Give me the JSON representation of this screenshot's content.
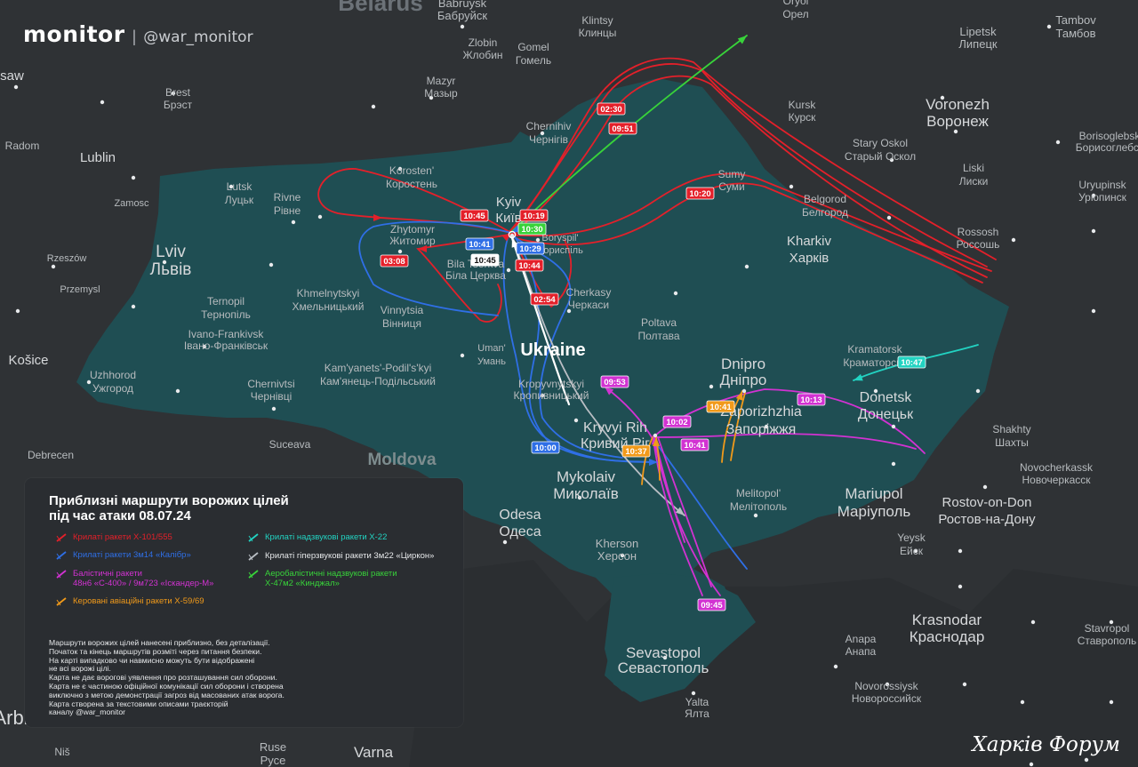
{
  "brand": {
    "name": "monitor",
    "separator": "|",
    "handle": "@war_monitor"
  },
  "watermark": "Харків Форум",
  "colors": {
    "ocean": "#2b2e31",
    "land_other": "#2f3235",
    "land_ukraine": "#1f4e53",
    "label": "#d0d2d4",
    "red": "#e4202a",
    "blue": "#2f6fe6",
    "magenta": "#d232d2",
    "orange": "#f19a1a",
    "cyan": "#22d3c2",
    "gray": "#b9bec4",
    "green": "#38d33a",
    "white": "#ffffff"
  },
  "country_labels": [
    {
      "text": "Belarus"
    },
    {
      "text": "Moldova"
    },
    {
      "text": "Ukraine"
    }
  ],
  "city_labels": [
    {
      "text": "Warsaw"
    },
    {
      "text": "Brest"
    },
    {
      "text": "Брэст"
    },
    {
      "text": "Lublin"
    },
    {
      "text": "Radom"
    },
    {
      "text": "Zamosc"
    },
    {
      "text": "Rzeszów"
    },
    {
      "text": "Przemysl"
    },
    {
      "text": "Košice"
    },
    {
      "text": "Debrecen"
    },
    {
      "text": "Babruysk"
    },
    {
      "text": "Бабруйск"
    },
    {
      "text": "Zlobin"
    },
    {
      "text": "Жлобин"
    },
    {
      "text": "Gomel"
    },
    {
      "text": "Гомель"
    },
    {
      "text": "Mazyr"
    },
    {
      "text": "Мазыр"
    },
    {
      "text": "Klintsy"
    },
    {
      "text": "Клинцы"
    },
    {
      "text": "Oryol"
    },
    {
      "text": "Орел"
    },
    {
      "text": "Tambov"
    },
    {
      "text": "Тамбов"
    },
    {
      "text": "Lipetsk"
    },
    {
      "text": "Липецк"
    },
    {
      "text": "Voronezh"
    },
    {
      "text": "Воронеж"
    },
    {
      "text": "Kursk"
    },
    {
      "text": "Курск"
    },
    {
      "text": "Stary Oskol"
    },
    {
      "text": "Старый Оскол"
    },
    {
      "text": "Borisoglebsk"
    },
    {
      "text": "Борисоглебск"
    },
    {
      "text": "Liski"
    },
    {
      "text": "Лиски"
    },
    {
      "text": "Uryupinsk"
    },
    {
      "text": "Урюпинск"
    },
    {
      "text": "Rossosh"
    },
    {
      "text": "Россошь"
    },
    {
      "text": "Chernihiv"
    },
    {
      "text": "Чернігів"
    },
    {
      "text": "Korosten'"
    },
    {
      "text": "Коростень"
    },
    {
      "text": "Lutsk"
    },
    {
      "text": "Луцьк"
    },
    {
      "text": "Rivne"
    },
    {
      "text": "Рівне"
    },
    {
      "text": "Lviv"
    },
    {
      "text": "Львів"
    },
    {
      "text": "Zhytomyr"
    },
    {
      "text": "Житомир"
    },
    {
      "text": "Kyiv"
    },
    {
      "text": "Київ"
    },
    {
      "text": "Boryspil'"
    },
    {
      "text": "Бориспіль"
    },
    {
      "text": "Sumy"
    },
    {
      "text": "Суми"
    },
    {
      "text": "Belgorod"
    },
    {
      "text": "Белгород"
    },
    {
      "text": "Kharkiv"
    },
    {
      "text": "Харків"
    },
    {
      "text": "Ternopil"
    },
    {
      "text": "Тернопіль"
    },
    {
      "text": "Khmelnytskyi"
    },
    {
      "text": "Хмельницький"
    },
    {
      "text": "Vinnytsia"
    },
    {
      "text": "Вінниця"
    },
    {
      "text": "Bila Tserkva"
    },
    {
      "text": "Біла Церква"
    },
    {
      "text": "Cherkasy"
    },
    {
      "text": "Черкаси"
    },
    {
      "text": "Poltava"
    },
    {
      "text": "Полтава"
    },
    {
      "text": "Ivano-Frankivsk"
    },
    {
      "text": "Івано-Франківськ"
    },
    {
      "text": "Kremenchuk"
    },
    {
      "text": "Кременчук"
    },
    {
      "text": "Uman'"
    },
    {
      "text": "Умань"
    },
    {
      "text": "Uzhhorod"
    },
    {
      "text": "Ужгород"
    },
    {
      "text": "Kam'yanets'-Podil's'kyi"
    },
    {
      "text": "Кам'янець-Подільський"
    },
    {
      "text": "Chernivtsi"
    },
    {
      "text": "Чернівці"
    },
    {
      "text": "Kropyvnytskyi"
    },
    {
      "text": "Кропивницький"
    },
    {
      "text": "Dnipro"
    },
    {
      "text": "Дніпро"
    },
    {
      "text": "Kramatorsk"
    },
    {
      "text": "Краматорськ"
    },
    {
      "text": "Donetsk"
    },
    {
      "text": "Донецьк"
    },
    {
      "text": "Kryvyi Rih"
    },
    {
      "text": "Кривий Ріг"
    },
    {
      "text": "Zaporizhzhia"
    },
    {
      "text": "Запоріжжя"
    },
    {
      "text": "Shakhty"
    },
    {
      "text": "Шахты"
    },
    {
      "text": "Novocherkassk"
    },
    {
      "text": "Новочеркасск"
    },
    {
      "text": "Mariupol"
    },
    {
      "text": "Маріуполь"
    },
    {
      "text": "Rostov-on-Don"
    },
    {
      "text": "Ростов-на-Дону"
    },
    {
      "text": "Mykolaiv"
    },
    {
      "text": "Миколаїв"
    },
    {
      "text": "Odesa"
    },
    {
      "text": "Одеса"
    },
    {
      "text": "Melitopol'"
    },
    {
      "text": "Мелітополь"
    },
    {
      "text": "Yeysk"
    },
    {
      "text": "Ейск"
    },
    {
      "text": "Kherson"
    },
    {
      "text": "Херсон"
    },
    {
      "text": "Krasnodar"
    },
    {
      "text": "Краснодар"
    },
    {
      "text": "Stavropol"
    },
    {
      "text": "Ставрополь"
    },
    {
      "text": "Anapa"
    },
    {
      "text": "Анапа"
    },
    {
      "text": "Sevastopol"
    },
    {
      "text": "Севастополь"
    },
    {
      "text": "Novorossiysk"
    },
    {
      "text": "Новороссийск"
    },
    {
      "text": "Yalta"
    },
    {
      "text": "Ялта"
    },
    {
      "text": "Suceava"
    },
    {
      "text": "Ruse"
    },
    {
      "text": "Русе"
    },
    {
      "text": "Varna"
    },
    {
      "text": "Варна"
    },
    {
      "text": "Niš"
    },
    {
      "text": "Ниш"
    },
    {
      "text": "Arbi"
    },
    {
      "text": "Black Sea"
    }
  ],
  "time_tags": [
    {
      "text": "02:30",
      "kind": "red"
    },
    {
      "text": "09:51",
      "kind": "red"
    },
    {
      "text": "10:20",
      "kind": "red"
    },
    {
      "text": "10:45",
      "kind": "red"
    },
    {
      "text": "10:19",
      "kind": "red"
    },
    {
      "text": "10:30",
      "kind": "green"
    },
    {
      "text": "10:41",
      "kind": "blue"
    },
    {
      "text": "10:29",
      "kind": "blue"
    },
    {
      "text": "10:45",
      "kind": "white"
    },
    {
      "text": "10:44",
      "kind": "red"
    },
    {
      "text": "03:08",
      "kind": "red"
    },
    {
      "text": "02:54",
      "kind": "red"
    },
    {
      "text": "09:53",
      "kind": "magenta"
    },
    {
      "text": "10:02",
      "kind": "magenta"
    },
    {
      "text": "10:41",
      "kind": "magenta"
    },
    {
      "text": "10:41",
      "kind": "orange"
    },
    {
      "text": "10:13",
      "kind": "magenta"
    },
    {
      "text": "10:37",
      "kind": "orange"
    },
    {
      "text": "10:00",
      "kind": "blue"
    },
    {
      "text": "10:47",
      "kind": "cyan"
    },
    {
      "text": "09:45",
      "kind": "magenta"
    }
  ],
  "legend": {
    "title_lines": [
      "Приблизні маршрути ворожих цілей",
      "під час атаки 08.07.24"
    ],
    "items": [
      {
        "kind": "red",
        "lines": [
          "Крилаті ракети Х-101/555"
        ]
      },
      {
        "kind": "blue",
        "lines": [
          "Крилаті ракети 3м14 «Калібр»"
        ]
      },
      {
        "kind": "magenta",
        "lines": [
          "Балістичні ракети",
          "48н6 «С-400» / 9м723 «Іскандер-М»"
        ]
      },
      {
        "kind": "orange",
        "lines": [
          "Керовані авіаційні ракети Х-59/69"
        ]
      },
      {
        "kind": "cyan",
        "lines": [
          "Крилаті надзвукові ракети Х-22"
        ]
      },
      {
        "kind": "gray",
        "lines": [
          "Крилаті гіперзвукові ракети 3м22 «Циркон»"
        ]
      },
      {
        "kind": "green",
        "lines": [
          "Аеробалістичні надзвукові ракети",
          "Х-47м2 «Кинджал»"
        ]
      }
    ],
    "note_lines": [
      "Маршрути ворожих цілей нанесені приблизно, без деталізації.",
      "Початок та кінець маршрутів розміті через питання безпеки.",
      "На карті випадково чи навмисно можуть бути відображені",
      "не всі ворожі цілі.",
      "Карта не дає ворогові уявлення про розташування сил оборони.",
      "Карта не є частиною офіційної комунікації сил оборони і створена",
      "виключно з метою демонстрації загроз від масованих атак ворога.",
      "Карта створена за текстовими описами траєкторій",
      "каналу @war_monitor"
    ]
  }
}
